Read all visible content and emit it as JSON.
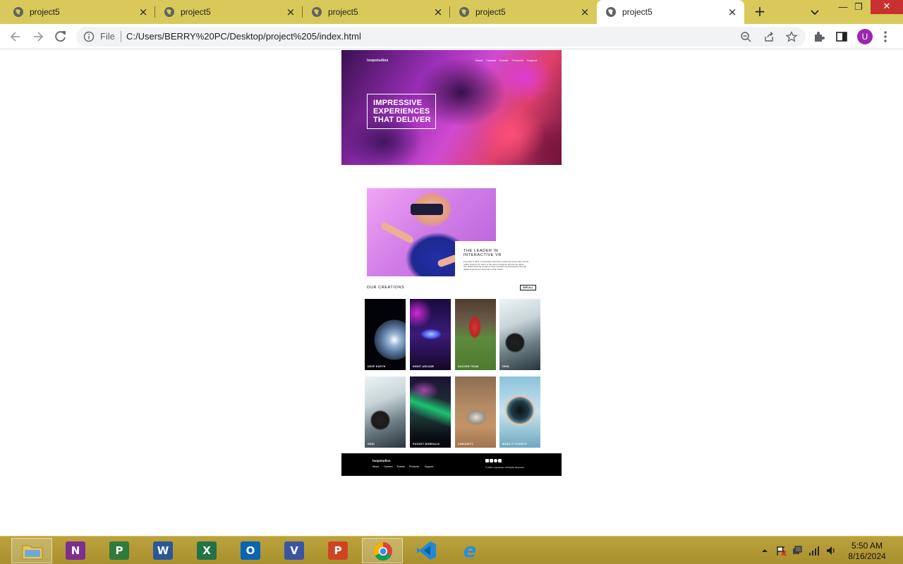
{
  "browser": {
    "tabs": [
      {
        "title": "project5",
        "active": false
      },
      {
        "title": "project5",
        "active": false
      },
      {
        "title": "project5",
        "active": false
      },
      {
        "title": "project5",
        "active": false
      },
      {
        "title": "project5",
        "active": true
      }
    ],
    "new_tab_label": "+",
    "address": {
      "scheme_label": "File",
      "url": "C:/Users/BERRY%20PC/Desktop/project%205/index.html"
    },
    "profile_initial": "U",
    "window_buttons": {
      "minimize": "—",
      "restore": "❐",
      "close": "✕"
    }
  },
  "site": {
    "header": {
      "logo": "loopstudios",
      "nav": [
        "About",
        "Careers",
        "Events",
        "Products",
        "Support"
      ]
    },
    "hero": {
      "lines": [
        "IMPRESSIVE",
        "EXPERIENCES",
        "THAT DELIVER"
      ]
    },
    "leader": {
      "title_line1": "THE LEADER IN",
      "title_line2": "INTERACTIVE VR",
      "body": "Founded in 2011, Loopstudios has been producing world-class virtual reality projects for some of the best companies around the globe. Our award-winning creations have transformed businesses through digital experiences that bind to their brand."
    },
    "creations": {
      "title": "OUR CREATIONS",
      "see_all": "SEE ALL",
      "cards": [
        {
          "label": "DEEP EARTH",
          "theme": "earth"
        },
        {
          "label": "NIGHT ARCADE",
          "theme": "vrm"
        },
        {
          "label": "SOCCER TEAM",
          "theme": "soccer"
        },
        {
          "label": "GRID",
          "theme": "car"
        },
        {
          "label": "GRID",
          "theme": "car"
        },
        {
          "label": "POCKET BOREALIS",
          "theme": "aurora"
        },
        {
          "label": "CURIOSITY",
          "theme": "rover"
        },
        {
          "label": "MAKE IT FISHEYE",
          "theme": "eye"
        }
      ]
    },
    "footer": {
      "logo": "loopstudios",
      "links": [
        "About",
        "Careers",
        "Events",
        "Products",
        "Support"
      ],
      "social": [
        "facebook-icon",
        "twitter-icon",
        "pinterest-icon",
        "instagram-icon"
      ],
      "copyright": "© 2021 Loopstudios. All Rights Reserved."
    }
  },
  "taskbar": {
    "apps": [
      {
        "name": "file-explorer",
        "glyph": "",
        "color": "#e6c65a",
        "running": true
      },
      {
        "name": "onenote",
        "glyph": "N",
        "color": "#7b2f8f",
        "running": false
      },
      {
        "name": "project",
        "glyph": "P",
        "color": "#2f7a3c",
        "running": false
      },
      {
        "name": "word",
        "glyph": "W",
        "color": "#2b579a",
        "running": false
      },
      {
        "name": "excel",
        "glyph": "X",
        "color": "#217346",
        "running": false
      },
      {
        "name": "outlook",
        "glyph": "O",
        "color": "#0a64b4",
        "running": false
      },
      {
        "name": "visio",
        "glyph": "V",
        "color": "#3955a3",
        "running": false
      },
      {
        "name": "powerpoint",
        "glyph": "P",
        "color": "#d04423",
        "running": false
      },
      {
        "name": "chrome",
        "glyph": "",
        "color": "#ffffff",
        "running": true
      },
      {
        "name": "vscode",
        "glyph": "",
        "color": "#1e8ad6",
        "running": false
      },
      {
        "name": "internet-explorer",
        "glyph": "e",
        "color": "#2a8ee0",
        "running": false
      }
    ],
    "clock": {
      "time": "5:50 AM",
      "date": "8/16/2024"
    }
  }
}
